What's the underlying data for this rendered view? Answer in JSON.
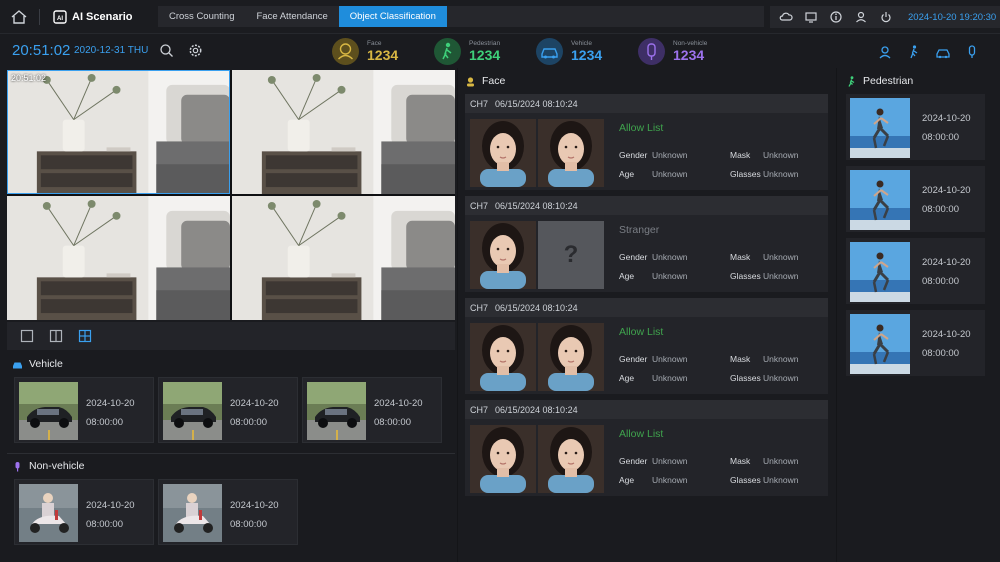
{
  "app": {
    "title": "AI Scenario"
  },
  "tabs": [
    {
      "label": "Cross Counting",
      "active": false
    },
    {
      "label": "Face Attendance",
      "active": false
    },
    {
      "label": "Object Classification",
      "active": true
    }
  ],
  "topbar": {
    "datetime": "2024-10-20  19:20:30"
  },
  "status": {
    "clock": "20:51:02",
    "date": "2020-12-31  THU"
  },
  "stats": [
    {
      "label": "Face",
      "value": "1234",
      "color": "#d8b743"
    },
    {
      "label": "Pedestrian",
      "value": "1234",
      "color": "#3ed07a"
    },
    {
      "label": "Vehicle",
      "value": "1234",
      "color": "#3aa0ef"
    },
    {
      "label": "Non-vehicle",
      "value": "1234",
      "color": "#9d72ee"
    }
  ],
  "cameras": [
    {
      "label": "20:51:02"
    },
    {
      "label": ""
    },
    {
      "label": ""
    },
    {
      "label": ""
    }
  ],
  "vehicle": {
    "title": "Vehicle",
    "items": [
      {
        "date": "2024-10-20",
        "time": "08:00:00"
      },
      {
        "date": "2024-10-20",
        "time": "08:00:00"
      },
      {
        "date": "2024-10-20",
        "time": "08:00:00"
      }
    ]
  },
  "nonvehicle": {
    "title": "Non-vehicle",
    "items": [
      {
        "date": "2024-10-20",
        "time": "08:00:00"
      },
      {
        "date": "2024-10-20",
        "time": "08:00:00"
      }
    ]
  },
  "face": {
    "title": "Face",
    "items": [
      {
        "ch": "CH7",
        "datetime": "06/15/2024  08:10:24",
        "status": "Allow List",
        "status_color": "#3fa34d",
        "gender_label": "Gender",
        "gender": "Unknown",
        "age_label": "Age",
        "age": "Unknown",
        "mask_label": "Mask",
        "mask": "Unknown",
        "glasses_label": "Glasses",
        "glasses": "Unknown",
        "matched": true
      },
      {
        "ch": "CH7",
        "datetime": "06/15/2024  08:10:24",
        "status": "Stranger",
        "status_color": "#7a7e85",
        "gender_label": "Gender",
        "gender": "Unknown",
        "age_label": "Age",
        "age": "Unknown",
        "mask_label": "Mask",
        "mask": "Unknown",
        "glasses_label": "Glasses",
        "glasses": "Unknown",
        "matched": false,
        "unknown_mark": "?"
      },
      {
        "ch": "CH7",
        "datetime": "06/15/2024  08:10:24",
        "status": "Allow List",
        "status_color": "#3fa34d",
        "gender_label": "Gender",
        "gender": "Unknown",
        "age_label": "Age",
        "age": "Unknown",
        "mask_label": "Mask",
        "mask": "Unknown",
        "glasses_label": "Glasses",
        "glasses": "Unknown",
        "matched": true
      },
      {
        "ch": "CH7",
        "datetime": "06/15/2024  08:10:24",
        "status": "Allow List",
        "status_color": "#3fa34d",
        "gender_label": "Gender",
        "gender": "Unknown",
        "age_label": "Age",
        "age": "Unknown",
        "mask_label": "Mask",
        "mask": "Unknown",
        "glasses_label": "Glasses",
        "glasses": "Unknown",
        "matched": true
      }
    ]
  },
  "pedestrian": {
    "title": "Pedestrian",
    "items": [
      {
        "date": "2024-10-20",
        "time": "08:00:00"
      },
      {
        "date": "2024-10-20",
        "time": "08:00:00"
      },
      {
        "date": "2024-10-20",
        "time": "08:00:00"
      },
      {
        "date": "2024-10-20",
        "time": "08:00:00"
      }
    ]
  }
}
